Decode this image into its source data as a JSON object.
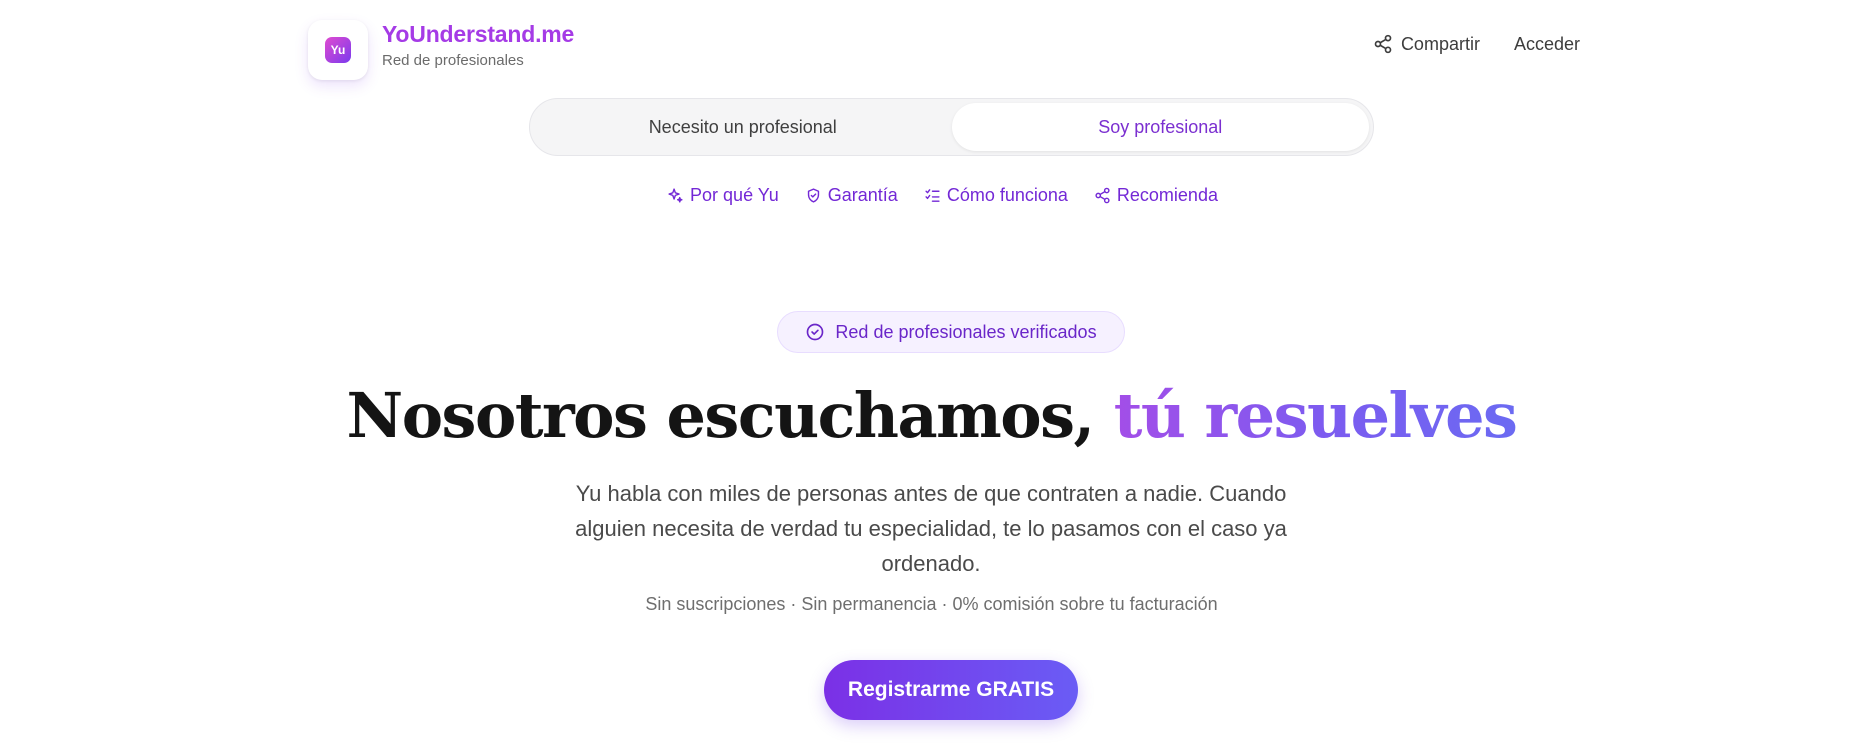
{
  "brand": {
    "logo_text": "Yu",
    "name": "YoUnderstand.me",
    "subtitle": "Red de profesionales"
  },
  "header": {
    "share_label": "Compartir",
    "login_label": "Acceder"
  },
  "toggle": {
    "options": [
      {
        "label": "Necesito un profesional",
        "active": false
      },
      {
        "label": "Soy profesional",
        "active": true
      }
    ]
  },
  "subnav": {
    "items": [
      {
        "label": "Por qué Yu",
        "icon": "sparkles-icon"
      },
      {
        "label": "Garantía",
        "icon": "shield-check-icon"
      },
      {
        "label": "Cómo funciona",
        "icon": "list-checks-icon"
      },
      {
        "label": "Recomienda",
        "icon": "share-icon"
      }
    ]
  },
  "hero": {
    "badge": "Red de profesionales verificados",
    "headline_main": "Nosotros escuchamos, ",
    "headline_accent": "tú resuelves",
    "lead": "Yu habla con miles de personas antes de que contraten a nadie. Cuando alguien necesita de verdad tu especialidad, te lo pasamos con el caso ya ordenado.",
    "fine_print": "Sin suscripciones · Sin permanencia · 0% comisión sobre tu facturación",
    "cta_label": "Registrarme GRATIS"
  },
  "colors": {
    "accent": "#7328d6",
    "brand": "#a53be6",
    "cta_start": "#7b30e6",
    "cta_end": "#6a5cf5"
  }
}
